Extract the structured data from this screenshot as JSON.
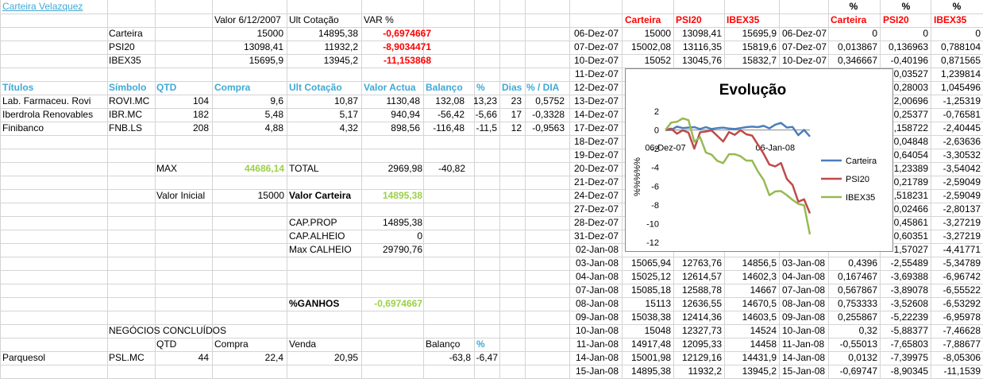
{
  "sheet": {
    "title": "Carteira Velazquez",
    "headers": {
      "valor": "Valor 6/12/2007",
      "ult": "Ult Cotação",
      "var": "VAR %"
    },
    "summary": [
      {
        "name": "Carteira",
        "valor": "15000",
        "ult": "14895,38",
        "var": "-0,6974667"
      },
      {
        "name": "PSI20",
        "valor": "13098,41",
        "ult": "11932,2",
        "var": "-8,9034471"
      },
      {
        "name": "IBEX35",
        "valor": "15695,9",
        "ult": "13945,2",
        "var": "-11,153868"
      }
    ],
    "holdings_headers": {
      "titulos": "Títulos",
      "simbolo": "Símbolo",
      "qtd": "QTD",
      "compra": "Compra",
      "ult": "Ult Cotação",
      "valor": "Valor Actua",
      "balanco": "Balanço",
      "pct": "%",
      "dias": "Dias",
      "pctdia": "% / DIA"
    },
    "holdings": [
      {
        "titulo": "Lab. Farmaceu. Rovi",
        "simbolo": "ROVI.MC",
        "qtd": "104",
        "compra": "9,6",
        "ult": "10,87",
        "valor": "1130,48",
        "balanco": "132,08",
        "pct": "13,23",
        "dias": "23",
        "pctdia": "0,5752"
      },
      {
        "titulo": "Iberdrola Renovables",
        "simbolo": "IBR.MC",
        "qtd": "182",
        "compra": "5,48",
        "ult": "5,17",
        "valor": "940,94",
        "balanco": "-56,42",
        "pct": "-5,66",
        "dias": "17",
        "pctdia": "-0,3328"
      },
      {
        "titulo": "Finibanco",
        "simbolo": "FNB.LS",
        "qtd": "208",
        "compra": "4,88",
        "ult": "4,32",
        "valor": "898,56",
        "balanco": "-116,48",
        "pct": "-11,5",
        "dias": "12",
        "pctdia": "-0,9563"
      }
    ],
    "max_label": "MAX",
    "max_value": "44686,14",
    "total_label": "TOTAL",
    "total_value": "2969,98",
    "total_balanco": "-40,82",
    "valor_inicial_label": "Valor Inicial",
    "valor_inicial": "15000",
    "valor_carteira_label": "Valor Carteira",
    "valor_carteira": "14895,38",
    "cap_prop_label": "CAP.PROP",
    "cap_prop": "14895,38",
    "cap_alheio_label": "CAP.ALHEIO",
    "cap_alheio": "0",
    "max_calheio_label": "Max CALHEIO",
    "max_calheio": "29790,76",
    "ganhos_label": "%GANHOS",
    "ganhos_value": "-0,6974667",
    "negocios_title": "NEGÓCIOS CONCLUÍDOS",
    "negocios_headers": {
      "qtd": "QTD",
      "compra": "Compra",
      "venda": "Venda",
      "balanco": "Balanço",
      "pct": "%"
    },
    "negocios": [
      {
        "nome": "Parquesol",
        "simbolo": "PSL.MC",
        "qtd": "44",
        "compra": "22,4",
        "venda": "20,95",
        "balanco": "-63,8",
        "pct": "-6,47"
      }
    ]
  },
  "history": {
    "headers": {
      "carteira": "Carteira",
      "psi": "PSI20",
      "ibex": "IBEX35"
    },
    "pct_headers": {
      "sym": "%",
      "carteira": "Carteira",
      "psi": "PSI20",
      "ibex": "IBEX35"
    },
    "rows": [
      {
        "date": "06-Dez-07",
        "carteira": "15000",
        "psi": "13098,41",
        "ibex": "15695,9",
        "date2": "06-Dez-07",
        "pc": "0",
        "pp": "0",
        "pi": "0"
      },
      {
        "date": "07-Dez-07",
        "carteira": "15002,08",
        "psi": "13116,35",
        "ibex": "15819,6",
        "date2": "07-Dez-07",
        "pc": "0,013867",
        "pp": "0,136963",
        "pi": "0,788104"
      },
      {
        "date": "10-Dez-07",
        "carteira": "15052",
        "psi": "13045,76",
        "ibex": "15832,7",
        "date2": "10-Dez-07",
        "pc": "0,346667",
        "pp": "-0,40196",
        "pi": "0,871565"
      },
      {
        "date": "11-Dez-07",
        "carteira": "",
        "psi": "",
        "ibex": "",
        "date2": "",
        "pc": "",
        "pp": "0,03527",
        "pi": "1,239814"
      },
      {
        "date": "12-Dez-07",
        "carteira": "",
        "psi": "",
        "ibex": "",
        "date2": "",
        "pc": "",
        "pp": "0,28003",
        "pi": "1,045496"
      },
      {
        "date": "13-Dez-07",
        "carteira": "",
        "psi": "",
        "ibex": "",
        "date2": "",
        "pc": "",
        "pp": "2,00696",
        "pi": "-1,25319"
      },
      {
        "date": "14-Dez-07",
        "carteira": "",
        "psi": "",
        "ibex": "",
        "date2": "",
        "pc": "",
        "pp": "0,25377",
        "pi": "-0,76581"
      },
      {
        "date": "17-Dez-07",
        "carteira": "",
        "psi": "",
        "ibex": "",
        "date2": "",
        "pc": "",
        "pp": ",158722",
        "pi": "-2,40445"
      },
      {
        "date": "18-Dez-07",
        "carteira": "",
        "psi": "",
        "ibex": "",
        "date2": "",
        "pc": "",
        "pp": "0,04848",
        "pi": "-2,63636"
      },
      {
        "date": "19-Dez-07",
        "carteira": "",
        "psi": "",
        "ibex": "",
        "date2": "",
        "pc": "",
        "pp": "0,64054",
        "pi": "-3,30532"
      },
      {
        "date": "20-Dez-07",
        "carteira": "",
        "psi": "",
        "ibex": "",
        "date2": "",
        "pc": "",
        "pp": "1,23389",
        "pi": "-3,54042"
      },
      {
        "date": "21-Dez-07",
        "carteira": "",
        "psi": "",
        "ibex": "",
        "date2": "",
        "pc": "",
        "pp": "0,21789",
        "pi": "-2,59049"
      },
      {
        "date": "24-Dez-07",
        "carteira": "",
        "psi": "",
        "ibex": "",
        "date2": "",
        "pc": "",
        "pp": ",518231",
        "pi": "-2,59049"
      },
      {
        "date": "27-Dez-07",
        "carteira": "",
        "psi": "",
        "ibex": "",
        "date2": "",
        "pc": "",
        "pp": "0,02466",
        "pi": "-2,80137"
      },
      {
        "date": "28-Dez-07",
        "carteira": "",
        "psi": "",
        "ibex": "",
        "date2": "",
        "pc": "",
        "pp": "0,45861",
        "pi": "-3,27219"
      },
      {
        "date": "31-Dez-07",
        "carteira": "",
        "psi": "",
        "ibex": "",
        "date2": "",
        "pc": "",
        "pp": "0,60351",
        "pi": "-3,27219"
      },
      {
        "date": "02-Jan-08",
        "carteira": "",
        "psi": "",
        "ibex": "",
        "date2": "",
        "pc": "",
        "pp": "1,57027",
        "pi": "-4,41771"
      },
      {
        "date": "03-Jan-08",
        "carteira": "15065,94",
        "psi": "12763,76",
        "ibex": "14856,5",
        "date2": "03-Jan-08",
        "pc": "0,4396",
        "pp": "-2,55489",
        "pi": "-5,34789"
      },
      {
        "date": "04-Jan-08",
        "carteira": "15025,12",
        "psi": "12614,57",
        "ibex": "14602,3",
        "date2": "04-Jan-08",
        "pc": "0,167467",
        "pp": "-3,69388",
        "pi": "-6,96742"
      },
      {
        "date": "07-Jan-08",
        "carteira": "15085,18",
        "psi": "12588,78",
        "ibex": "14667",
        "date2": "07-Jan-08",
        "pc": "0,567867",
        "pp": "-3,89078",
        "pi": "-6,55522"
      },
      {
        "date": "08-Jan-08",
        "carteira": "15113",
        "psi": "12636,55",
        "ibex": "14670,5",
        "date2": "08-Jan-08",
        "pc": "0,753333",
        "pp": "-3,52608",
        "pi": "-6,53292"
      },
      {
        "date": "09-Jan-08",
        "carteira": "15038,38",
        "psi": "12414,36",
        "ibex": "14603,5",
        "date2": "09-Jan-08",
        "pc": "0,255867",
        "pp": "-5,22239",
        "pi": "-6,95978"
      },
      {
        "date": "10-Jan-08",
        "carteira": "15048",
        "psi": "12327,73",
        "ibex": "14524",
        "date2": "10-Jan-08",
        "pc": "0,32",
        "pp": "-5,88377",
        "pi": "-7,46628"
      },
      {
        "date": "11-Jan-08",
        "carteira": "14917,48",
        "psi": "12095,33",
        "ibex": "14458",
        "date2": "11-Jan-08",
        "pc": "-0,55013",
        "pp": "-7,65803",
        "pi": "-7,88677"
      },
      {
        "date": "14-Jan-08",
        "carteira": "15001,98",
        "psi": "12129,16",
        "ibex": "14431,9",
        "date2": "14-Jan-08",
        "pc": "0,0132",
        "pp": "-7,39975",
        "pi": "-8,05306"
      },
      {
        "date": "15-Jan-08",
        "carteira": "14895,38",
        "psi": "11932,2",
        "ibex": "13945,2",
        "date2": "15-Jan-08",
        "pc": "-0,69747",
        "pp": "-8,90345",
        "pi": "-11,1539"
      }
    ]
  },
  "chart_data": {
    "type": "line",
    "title": "Evolução",
    "ylabel": "%%%%%",
    "xlabel": "",
    "ylim": [
      -12,
      2
    ],
    "yticks": [
      2,
      0,
      -2,
      -4,
      -6,
      -8,
      -10,
      -12
    ],
    "x_tick_labels": [
      "06-Dez-07",
      "06-Jan-08"
    ],
    "x": [
      "06-Dez-07",
      "07-Dez-07",
      "10-Dez-07",
      "11-Dez-07",
      "12-Dez-07",
      "13-Dez-07",
      "14-Dez-07",
      "17-Dez-07",
      "18-Dez-07",
      "19-Dez-07",
      "20-Dez-07",
      "21-Dez-07",
      "24-Dez-07",
      "27-Dez-07",
      "28-Dez-07",
      "31-Dez-07",
      "02-Jan-08",
      "03-Jan-08",
      "04-Jan-08",
      "07-Jan-08",
      "08-Jan-08",
      "09-Jan-08",
      "10-Jan-08",
      "11-Jan-08",
      "14-Jan-08",
      "15-Jan-08"
    ],
    "series": [
      {
        "name": "Carteira",
        "color": "#4a7ebb",
        "values": [
          0,
          0.01,
          0.35,
          0.2,
          0.25,
          0.3,
          0.1,
          0.3,
          0.1,
          0.2,
          0.25,
          0.15,
          0.1,
          0.2,
          0.3,
          0.35,
          0.3,
          0.44,
          0.17,
          0.57,
          0.75,
          0.26,
          0.32,
          -0.55,
          0.01,
          -0.7
        ]
      },
      {
        "name": "PSI20",
        "color": "#be4b48",
        "values": [
          0,
          0.14,
          -0.4,
          -0.04,
          -0.28,
          -2.0,
          -0.25,
          -0.16,
          -0.05,
          -0.64,
          -1.23,
          -0.22,
          -0.52,
          -0.02,
          -0.46,
          -0.6,
          -1.57,
          -2.55,
          -3.69,
          -3.89,
          -3.53,
          -5.22,
          -5.88,
          -7.66,
          -7.4,
          -8.9
        ]
      },
      {
        "name": "IBEX35",
        "color": "#98b954",
        "values": [
          0,
          0.79,
          0.87,
          1.24,
          1.05,
          -1.25,
          -0.77,
          -2.4,
          -2.64,
          -3.31,
          -3.54,
          -2.59,
          -2.59,
          -2.8,
          -3.27,
          -3.27,
          -4.42,
          -5.35,
          -6.97,
          -6.56,
          -6.53,
          -6.96,
          -7.47,
          -7.89,
          -8.05,
          -11.15
        ]
      }
    ],
    "legend_position": "right",
    "grid": false
  }
}
